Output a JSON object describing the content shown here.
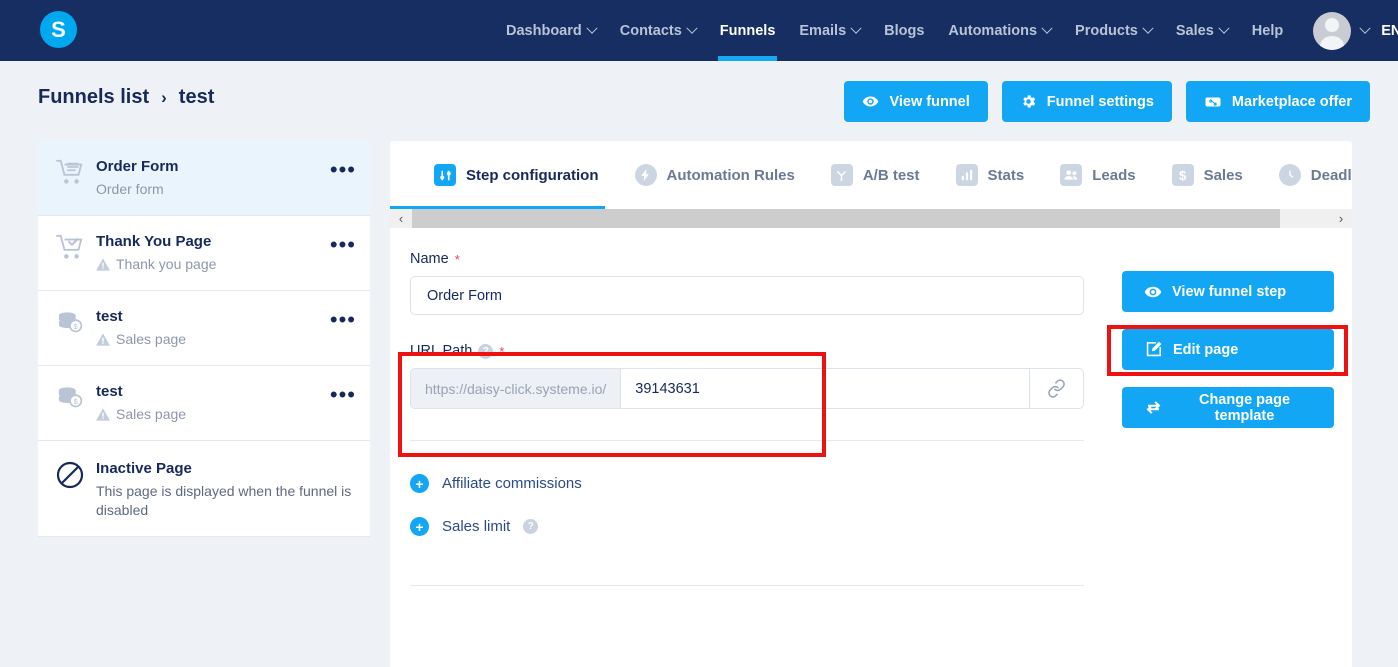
{
  "brand": {
    "logo_letter": "S"
  },
  "topnav": {
    "items": [
      {
        "label": "Dashboard",
        "has_caret": true,
        "active": false
      },
      {
        "label": "Contacts",
        "has_caret": true,
        "active": false
      },
      {
        "label": "Funnels",
        "has_caret": false,
        "active": true
      },
      {
        "label": "Emails",
        "has_caret": true,
        "active": false
      },
      {
        "label": "Blogs",
        "has_caret": false,
        "active": false
      },
      {
        "label": "Automations",
        "has_caret": true,
        "active": false
      },
      {
        "label": "Products",
        "has_caret": true,
        "active": false
      },
      {
        "label": "Sales",
        "has_caret": true,
        "active": false
      },
      {
        "label": "Help",
        "has_caret": false,
        "active": false
      }
    ],
    "language": "EN",
    "avatar_name": "user-avatar"
  },
  "breadcrumb": {
    "root": "Funnels list",
    "separator": "›",
    "current": "test"
  },
  "header_actions": [
    {
      "label": "View funnel",
      "icon": "eye-icon"
    },
    {
      "label": "Funnel settings",
      "icon": "gear-icon"
    },
    {
      "label": "Marketplace offer",
      "icon": "ticket-icon"
    }
  ],
  "sidebar": {
    "steps": [
      {
        "title": "Order Form",
        "subtitle": "Order form",
        "warning": false,
        "icon": "order-cart-icon",
        "active": true,
        "menu": "•••"
      },
      {
        "title": "Thank You Page",
        "subtitle": "Thank you page",
        "warning": true,
        "icon": "cart-check-icon",
        "active": false,
        "menu": "•••"
      },
      {
        "title": "test",
        "subtitle": "Sales page",
        "warning": true,
        "icon": "coins-icon",
        "active": false,
        "menu": "•••"
      },
      {
        "title": "test",
        "subtitle": "Sales page",
        "warning": true,
        "icon": "coins-icon",
        "active": false,
        "menu": "•••"
      }
    ],
    "inactive": {
      "title": "Inactive Page",
      "description": "This page is displayed when the funnel is disabled",
      "icon": "no-entry-icon"
    }
  },
  "tabs": [
    {
      "label": "Step configuration",
      "icon": "sliders-icon",
      "active": true
    },
    {
      "label": "Automation Rules",
      "icon": "bolt-icon",
      "active": false
    },
    {
      "label": "A/B test",
      "icon": "split-icon",
      "active": false
    },
    {
      "label": "Stats",
      "icon": "bars-icon",
      "active": false
    },
    {
      "label": "Leads",
      "icon": "people-icon",
      "active": false
    },
    {
      "label": "Sales",
      "icon": "dollar-icon",
      "active": false
    },
    {
      "label": "Deadline s",
      "icon": "clock-icon",
      "active": false
    }
  ],
  "tab_scroll": {
    "left_arrow": "‹",
    "right_arrow": "›"
  },
  "form": {
    "name": {
      "label": "Name",
      "required_mark": "*",
      "value": "Order Form"
    },
    "url_path": {
      "label": "URL Path",
      "help_glyph": "?",
      "required_mark": "*",
      "prefix": "https://daisy-click.systeme.io/",
      "value": "39143631",
      "link_icon": "link-icon"
    },
    "collapsibles": [
      {
        "label": "Affiliate commissions",
        "expander": "+",
        "has_help": false
      },
      {
        "label": "Sales limit",
        "expander": "+",
        "has_help": true,
        "help_glyph": "?"
      }
    ]
  },
  "side_actions": [
    {
      "label": "View funnel step",
      "icon": "eye-icon",
      "highlighted": false
    },
    {
      "label": "Edit page",
      "icon": "edit-page-icon",
      "highlighted": true
    },
    {
      "label": "Change page template",
      "icon": "swap-icon",
      "highlighted": false
    }
  ],
  "colors": {
    "nav_bg": "#162e61",
    "accent_blue": "#12a6f5",
    "page_bg": "#eef1f6",
    "text_dark": "#17295c",
    "text_muted": "#8c97ab",
    "highlight_red": "#ee1111",
    "active_step_bg": "#eaf4fd"
  }
}
